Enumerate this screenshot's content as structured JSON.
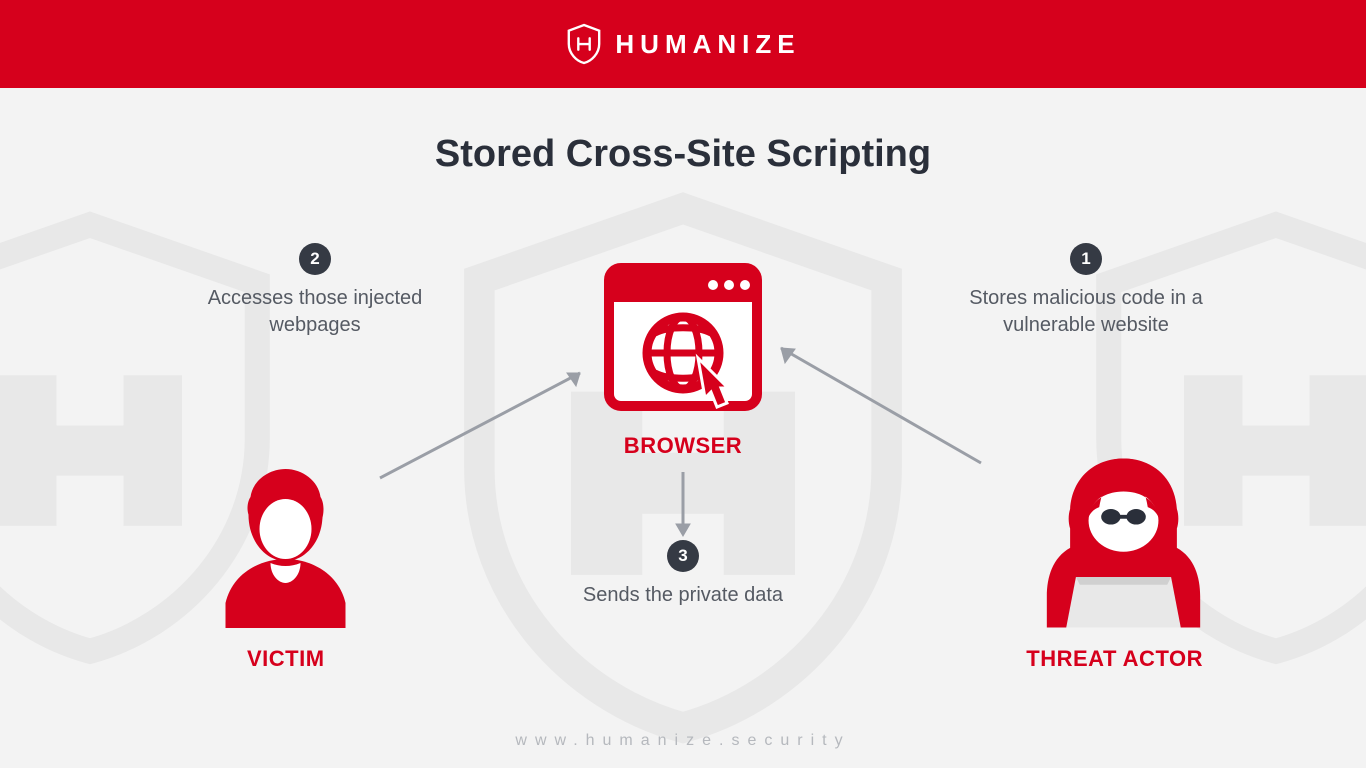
{
  "brand": "HUMANIZE",
  "title": "Stored Cross-Site Scripting",
  "steps": {
    "s1": {
      "num": "1",
      "text": "Stores malicious code in a vulnerable website"
    },
    "s2": {
      "num": "2",
      "text": "Accesses those injected webpages"
    },
    "s3": {
      "num": "3",
      "text": "Sends the private data"
    }
  },
  "entities": {
    "browser": "BROWSER",
    "victim": "VICTIM",
    "threat": "THREAT ACTOR"
  },
  "footer": "www.humanize.security",
  "colors": {
    "red": "#d6001c",
    "dark": "#353a44",
    "gray": "#9a9ea6"
  }
}
